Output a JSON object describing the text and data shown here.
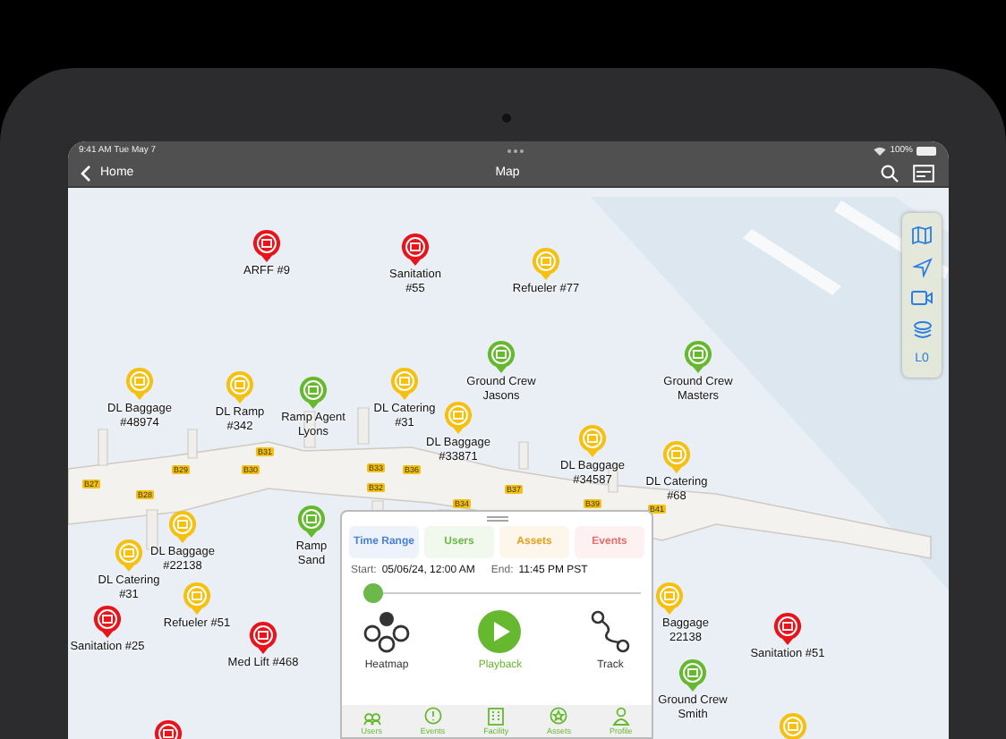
{
  "status_bar": {
    "time": "9:41 AM  Tue May 7",
    "battery": "100%"
  },
  "nav_bar": {
    "back": "Home",
    "title": "Map"
  },
  "pins": [
    {
      "label": "ARFF #9",
      "color": "#e8141b"
    },
    {
      "label": "Sanitation #55",
      "color": "#e8141b"
    },
    {
      "label": "Refueler #77",
      "color": "#f5c010"
    },
    {
      "label": "Ground Crew Jasons",
      "color": "#66b92e"
    },
    {
      "label": "Ground Crew Masters",
      "color": "#66b92e"
    },
    {
      "label": "DL Baggage #48974",
      "color": "#f5c010"
    },
    {
      "label": "DL Ramp #342",
      "color": "#f5c010"
    },
    {
      "label": "Ramp Agent Lyons",
      "color": "#66b92e"
    },
    {
      "label": "DL Catering #31",
      "color": "#f5c010"
    },
    {
      "label": "DL Baggage #33871",
      "color": "#f5c010"
    },
    {
      "label": "DL Baggage #34587",
      "color": "#f5c010"
    },
    {
      "label": "DL Catering #68",
      "color": "#f5c010"
    },
    {
      "label": "DL Catering #31",
      "color": "#f5c010"
    },
    {
      "label": "DL Baggage #22138",
      "color": "#f5c010"
    },
    {
      "label": "Refueler #51",
      "color": "#f5c010"
    },
    {
      "label": "Ramp Sand",
      "color": "#66b92e"
    },
    {
      "label": "Sanitation #25",
      "color": "#e8141b"
    },
    {
      "label": "Med Lift #468",
      "color": "#e8141b"
    },
    {
      "color": "#e8141b"
    },
    {
      "label": "Baggage 22138",
      "color": "#f5c010"
    },
    {
      "label": "Sanitation #51",
      "color": "#e8141b"
    },
    {
      "label": "Ground Crew Smith",
      "color": "#66b92e"
    },
    {
      "color": "#f5c010"
    }
  ],
  "gates": [
    "B27",
    "B28",
    "B29",
    "B30",
    "B31",
    "B32",
    "B33",
    "B36",
    "B34",
    "B37",
    "B39",
    "B41"
  ],
  "map_tools": {
    "level": "L0"
  },
  "panel": {
    "filters": [
      {
        "label": "Time Range",
        "color": "#4a7fd8"
      },
      {
        "label": "Users",
        "color": "#6cb84a"
      },
      {
        "label": "Assets",
        "color": "#e6a020"
      },
      {
        "label": "Events",
        "color": "#e86a6a"
      }
    ],
    "start_label": "Start:",
    "start": "05/06/24, 12:00 AM",
    "end_label": "End:",
    "end": "11:45 PM PST",
    "slider": {
      "level": 0.0
    },
    "actions": [
      {
        "kind": "heatmap",
        "label": "Heatmap",
        "selected": false
      },
      {
        "kind": "playback",
        "label": "Playback",
        "selected": true
      },
      {
        "kind": "track",
        "label": "Track",
        "selected": false
      }
    ],
    "tabs": [
      {
        "kind": "users",
        "label": "Users"
      },
      {
        "kind": "events",
        "label": "Events"
      },
      {
        "kind": "facility",
        "label": "Facility"
      },
      {
        "kind": "assets",
        "label": "Assets"
      },
      {
        "kind": "profile",
        "label": "Profile"
      }
    ]
  }
}
